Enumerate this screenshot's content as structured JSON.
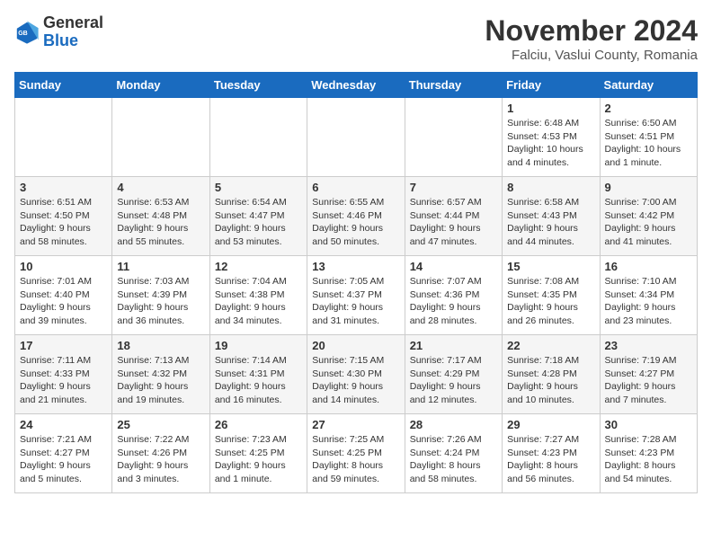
{
  "header": {
    "logo_general": "General",
    "logo_blue": "Blue",
    "month_title": "November 2024",
    "location": "Falciu, Vaslui County, Romania"
  },
  "days_of_week": [
    "Sunday",
    "Monday",
    "Tuesday",
    "Wednesday",
    "Thursday",
    "Friday",
    "Saturday"
  ],
  "weeks": [
    [
      {
        "day": "",
        "info": ""
      },
      {
        "day": "",
        "info": ""
      },
      {
        "day": "",
        "info": ""
      },
      {
        "day": "",
        "info": ""
      },
      {
        "day": "",
        "info": ""
      },
      {
        "day": "1",
        "info": "Sunrise: 6:48 AM\nSunset: 4:53 PM\nDaylight: 10 hours and 4 minutes."
      },
      {
        "day": "2",
        "info": "Sunrise: 6:50 AM\nSunset: 4:51 PM\nDaylight: 10 hours and 1 minute."
      }
    ],
    [
      {
        "day": "3",
        "info": "Sunrise: 6:51 AM\nSunset: 4:50 PM\nDaylight: 9 hours and 58 minutes."
      },
      {
        "day": "4",
        "info": "Sunrise: 6:53 AM\nSunset: 4:48 PM\nDaylight: 9 hours and 55 minutes."
      },
      {
        "day": "5",
        "info": "Sunrise: 6:54 AM\nSunset: 4:47 PM\nDaylight: 9 hours and 53 minutes."
      },
      {
        "day": "6",
        "info": "Sunrise: 6:55 AM\nSunset: 4:46 PM\nDaylight: 9 hours and 50 minutes."
      },
      {
        "day": "7",
        "info": "Sunrise: 6:57 AM\nSunset: 4:44 PM\nDaylight: 9 hours and 47 minutes."
      },
      {
        "day": "8",
        "info": "Sunrise: 6:58 AM\nSunset: 4:43 PM\nDaylight: 9 hours and 44 minutes."
      },
      {
        "day": "9",
        "info": "Sunrise: 7:00 AM\nSunset: 4:42 PM\nDaylight: 9 hours and 41 minutes."
      }
    ],
    [
      {
        "day": "10",
        "info": "Sunrise: 7:01 AM\nSunset: 4:40 PM\nDaylight: 9 hours and 39 minutes."
      },
      {
        "day": "11",
        "info": "Sunrise: 7:03 AM\nSunset: 4:39 PM\nDaylight: 9 hours and 36 minutes."
      },
      {
        "day": "12",
        "info": "Sunrise: 7:04 AM\nSunset: 4:38 PM\nDaylight: 9 hours and 34 minutes."
      },
      {
        "day": "13",
        "info": "Sunrise: 7:05 AM\nSunset: 4:37 PM\nDaylight: 9 hours and 31 minutes."
      },
      {
        "day": "14",
        "info": "Sunrise: 7:07 AM\nSunset: 4:36 PM\nDaylight: 9 hours and 28 minutes."
      },
      {
        "day": "15",
        "info": "Sunrise: 7:08 AM\nSunset: 4:35 PM\nDaylight: 9 hours and 26 minutes."
      },
      {
        "day": "16",
        "info": "Sunrise: 7:10 AM\nSunset: 4:34 PM\nDaylight: 9 hours and 23 minutes."
      }
    ],
    [
      {
        "day": "17",
        "info": "Sunrise: 7:11 AM\nSunset: 4:33 PM\nDaylight: 9 hours and 21 minutes."
      },
      {
        "day": "18",
        "info": "Sunrise: 7:13 AM\nSunset: 4:32 PM\nDaylight: 9 hours and 19 minutes."
      },
      {
        "day": "19",
        "info": "Sunrise: 7:14 AM\nSunset: 4:31 PM\nDaylight: 9 hours and 16 minutes."
      },
      {
        "day": "20",
        "info": "Sunrise: 7:15 AM\nSunset: 4:30 PM\nDaylight: 9 hours and 14 minutes."
      },
      {
        "day": "21",
        "info": "Sunrise: 7:17 AM\nSunset: 4:29 PM\nDaylight: 9 hours and 12 minutes."
      },
      {
        "day": "22",
        "info": "Sunrise: 7:18 AM\nSunset: 4:28 PM\nDaylight: 9 hours and 10 minutes."
      },
      {
        "day": "23",
        "info": "Sunrise: 7:19 AM\nSunset: 4:27 PM\nDaylight: 9 hours and 7 minutes."
      }
    ],
    [
      {
        "day": "24",
        "info": "Sunrise: 7:21 AM\nSunset: 4:27 PM\nDaylight: 9 hours and 5 minutes."
      },
      {
        "day": "25",
        "info": "Sunrise: 7:22 AM\nSunset: 4:26 PM\nDaylight: 9 hours and 3 minutes."
      },
      {
        "day": "26",
        "info": "Sunrise: 7:23 AM\nSunset: 4:25 PM\nDaylight: 9 hours and 1 minute."
      },
      {
        "day": "27",
        "info": "Sunrise: 7:25 AM\nSunset: 4:25 PM\nDaylight: 8 hours and 59 minutes."
      },
      {
        "day": "28",
        "info": "Sunrise: 7:26 AM\nSunset: 4:24 PM\nDaylight: 8 hours and 58 minutes."
      },
      {
        "day": "29",
        "info": "Sunrise: 7:27 AM\nSunset: 4:23 PM\nDaylight: 8 hours and 56 minutes."
      },
      {
        "day": "30",
        "info": "Sunrise: 7:28 AM\nSunset: 4:23 PM\nDaylight: 8 hours and 54 minutes."
      }
    ]
  ]
}
